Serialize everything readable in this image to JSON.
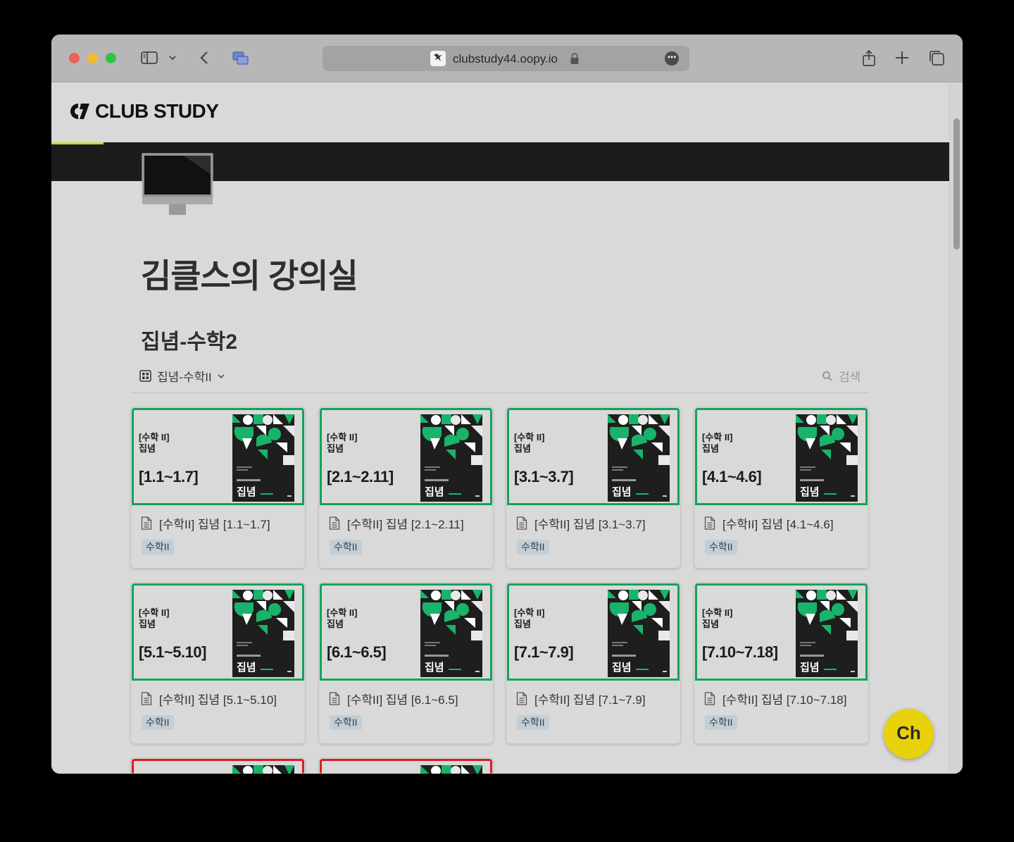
{
  "browser": {
    "url": "clubstudy44.oopy.io"
  },
  "site": {
    "logo_text": "CLUB STUDY"
  },
  "page": {
    "title": "김클스의 강의실",
    "section_title": "집념-수학2"
  },
  "database": {
    "view_name": "집념-수학II",
    "search_label": "검색"
  },
  "cards": [
    {
      "subject": "[수학 II]",
      "series": "집념",
      "range": "[1.1~1.7]",
      "book_title": "집념",
      "name": "[수학II] 집념 [1.1~1.7]",
      "tag": "수학II",
      "border": "green"
    },
    {
      "subject": "[수학 II]",
      "series": "집념",
      "range": "[2.1~2.11]",
      "book_title": "집념",
      "name": "[수학II] 집념 [2.1~2.11]",
      "tag": "수학II",
      "border": "green"
    },
    {
      "subject": "[수학 II]",
      "series": "집념",
      "range": "[3.1~3.7]",
      "book_title": "집념",
      "name": "[수학II] 집념 [3.1~3.7]",
      "tag": "수학II",
      "border": "green"
    },
    {
      "subject": "[수학 II]",
      "series": "집념",
      "range": "[4.1~4.6]",
      "book_title": "집념",
      "name": "[수학II] 집념 [4.1~4.6]",
      "tag": "수학II",
      "border": "green"
    },
    {
      "subject": "[수학 II]",
      "series": "집념",
      "range": "[5.1~5.10]",
      "book_title": "집념",
      "name": "[수학II] 집념 [5.1~5.10]",
      "tag": "수학II",
      "border": "green"
    },
    {
      "subject": "[수학 II]",
      "series": "집념",
      "range": "[6.1~6.5]",
      "book_title": "집념",
      "name": "[수학II] 집념 [6.1~6.5]",
      "tag": "수학II",
      "border": "green"
    },
    {
      "subject": "[수학 II]",
      "series": "집념",
      "range": "[7.1~7.9]",
      "book_title": "집념",
      "name": "[수학II] 집념 [7.1~7.9]",
      "tag": "수학II",
      "border": "green"
    },
    {
      "subject": "[수학 II]",
      "series": "집념",
      "range": "[7.10~7.18]",
      "book_title": "집념",
      "name": "[수학II] 집념 [7.10~7.18]",
      "tag": "수학II",
      "border": "green"
    }
  ],
  "partial_cards": [
    {
      "border": "red"
    },
    {
      "border": "red"
    }
  ],
  "chat_button": {
    "label": "Ch"
  },
  "colors": {
    "accent_green": "#12a35b",
    "accent_red": "#d61f1f",
    "chat_yellow": "#e8d20c",
    "banner": "#1c1c1c"
  }
}
